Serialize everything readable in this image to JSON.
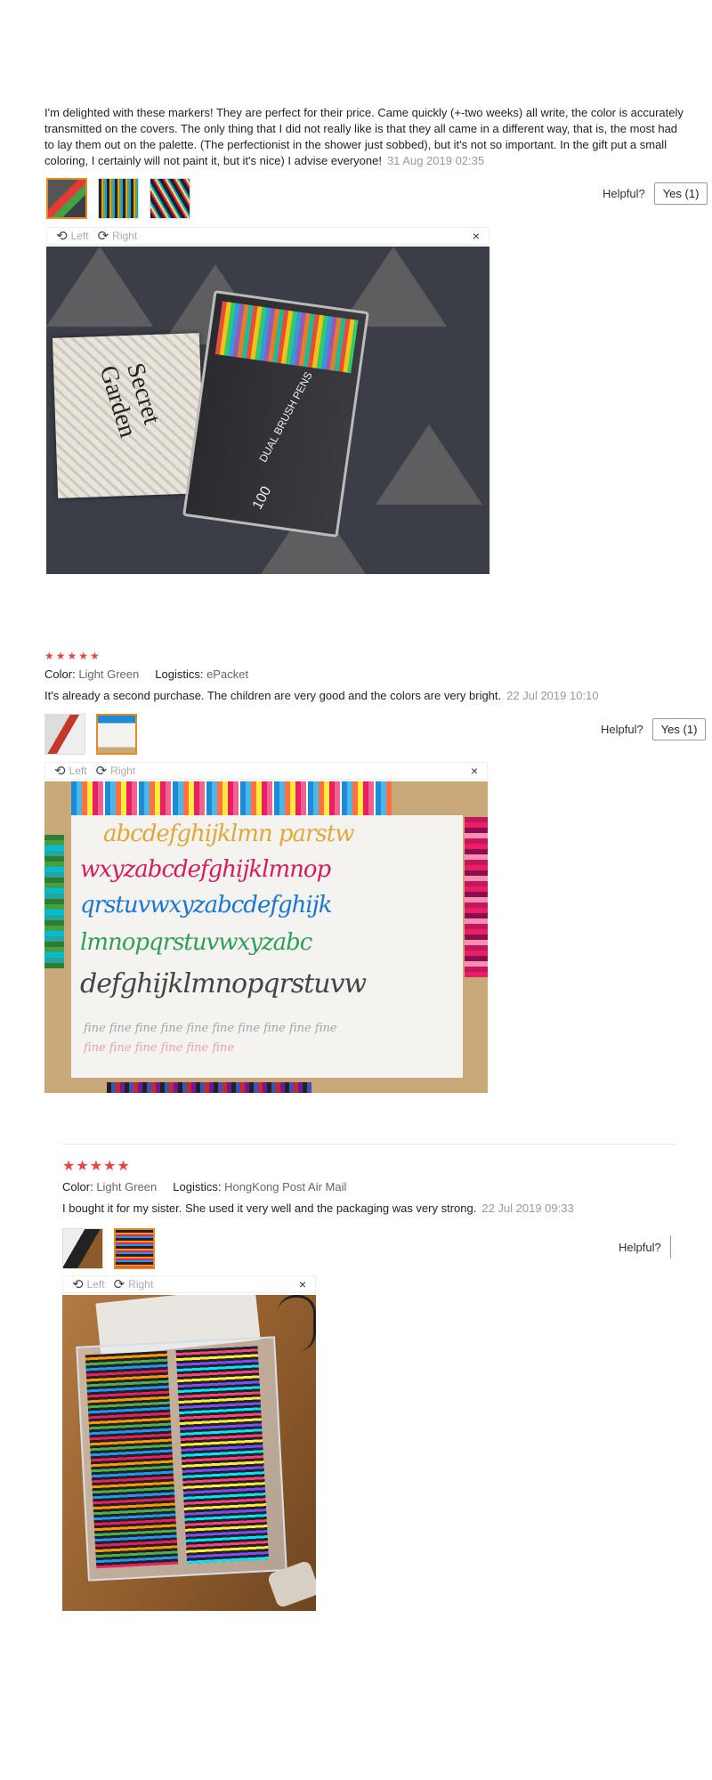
{
  "reviews": [
    {
      "text": "I'm delighted with these markers! They are perfect for their price. Came quickly (+-two weeks) all write, the color is accurately transmitted on the covers. The only thing that I did not really like is that they all came in a different way, that is, the most had to lay them out on the palette. (The perfectionist in the shower just sobbed), but it's not so important. In the gift put a small coloring, I certainly will not paint it, but it's nice) I advise everyone!",
      "date": "31 Aug 2019 02:35",
      "helpful_label": "Helpful?",
      "yes_label": "Yes (1)",
      "viewer": {
        "left_label": "Left",
        "right_label": "Right",
        "close_glyph": "×"
      },
      "photo_text": {
        "book_title": "Secret Garden",
        "box_label": "DUAL BRUSH PENS",
        "box_count": "100"
      }
    },
    {
      "stars": "★★★★★",
      "color_label": "Color:",
      "color_value": "Light Green",
      "logistics_label": "Logistics:",
      "logistics_value": "ePacket",
      "text": "It's already a second purchase. The children are very good and the colors are very bright.",
      "date": "22 Jul 2019 10:10",
      "helpful_label": "Helpful?",
      "yes_label": "Yes (1)",
      "viewer": {
        "left_label": "Left",
        "right_label": "Right",
        "close_glyph": "×"
      },
      "photo_text": {
        "line1": "abcdefghijklmn parstw",
        "line2": "wxyzabcdefghijklmnop",
        "line3": "qrstuvwxyzabcdefghijk",
        "line4": "lmnopqrstuvwxyzabc",
        "line5": "defghijklmnopqrstuvw",
        "fine_row": "fine fine fine fine fine   fine fine fine fine fine",
        "fine_row2": "fine fine fine fine   fine   fine"
      }
    },
    {
      "stars": "★★★★★",
      "color_label": "Color:",
      "color_value": "Light Green",
      "logistics_label": "Logistics:",
      "logistics_value": "HongKong Post Air Mail",
      "text": "I bought it for my sister. She used it very well and the packaging was very strong.",
      "date": "22 Jul 2019 09:33",
      "helpful_label": "Helpful?",
      "viewer": {
        "left_label": "Left",
        "right_label": "Right",
        "close_glyph": "×"
      }
    }
  ],
  "colors": {
    "star": "#e64545",
    "active_thumb": "#e58a1e"
  }
}
